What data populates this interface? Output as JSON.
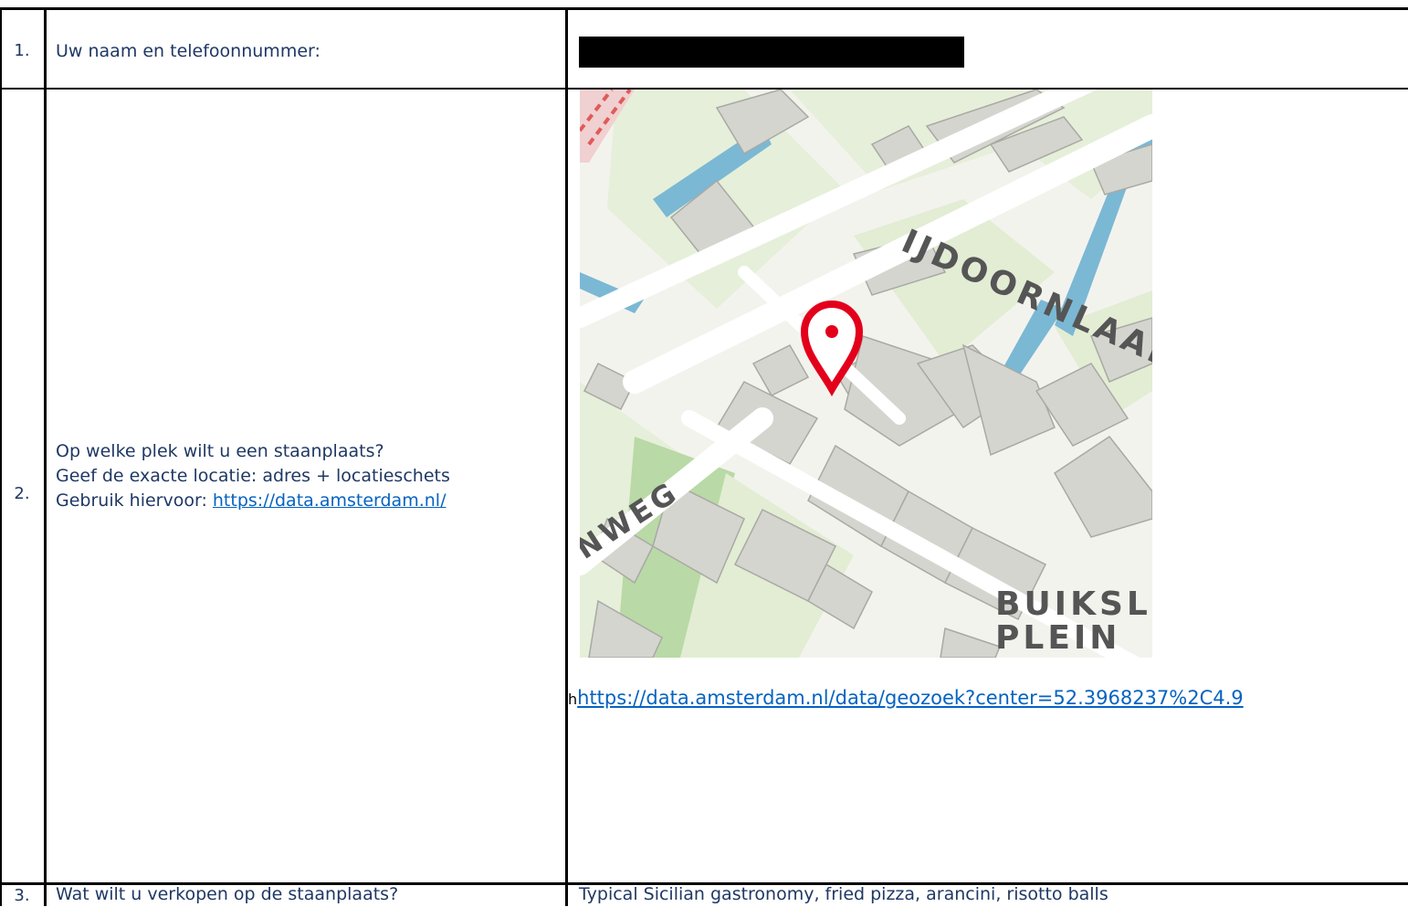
{
  "rows": [
    {
      "number": "1.",
      "question": "Uw naam en telefoonnummer:"
    },
    {
      "number": "2.",
      "question_lines": [
        "Op welke plek wilt u een staanplaats?",
        "Geef de exacte locatie: adres + locatieschets"
      ],
      "hint_prefix": "Gebruik hiervoor: ",
      "hint_link": "https://data.amsterdam.nl/",
      "answer_prefix": "h",
      "answer_link": "https://data.amsterdam.nl/data/geozoek?center=52.3968237%2C4.9"
    },
    {
      "number": "3.",
      "question": "Wat wilt u verkopen op de staanplaats?",
      "answer": "Typical Sicilian gastronomy, fried pizza, arancini, risotto balls"
    }
  ],
  "map": {
    "labels": {
      "street_1": "IJDOORNLAAN",
      "street_2": "NWEG",
      "place_1": "BUIKSL",
      "place_2": "PLEIN"
    },
    "colors": {
      "background": "#f3f3ee",
      "park": "#e2edd4",
      "green": "#b9d9a6",
      "building": "#d5d5d0",
      "building_edge": "#a9a9a4",
      "water": "#7bb8d4",
      "road": "#ffffff",
      "marker": "#e3001b"
    },
    "icon": "location-pin-icon"
  }
}
